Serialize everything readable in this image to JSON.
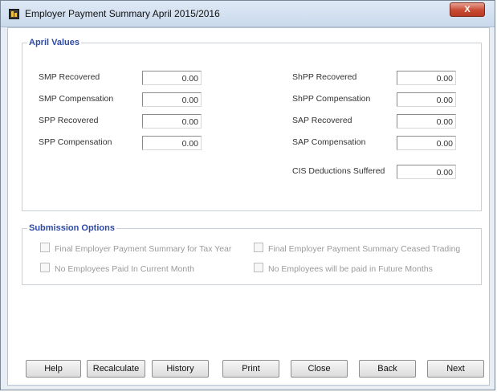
{
  "window": {
    "title": "Employer Payment Summary April 2015/2016",
    "close_label": "X"
  },
  "april_values": {
    "legend": "April Values",
    "left": [
      {
        "label": "SMP Recovered",
        "value": "0.00"
      },
      {
        "label": "SMP Compensation",
        "value": "0.00"
      },
      {
        "label": "SPP Recovered",
        "value": "0.00"
      },
      {
        "label": "SPP Compensation",
        "value": "0.00"
      }
    ],
    "right": [
      {
        "label": "ShPP Recovered",
        "value": "0.00"
      },
      {
        "label": "ShPP Compensation",
        "value": "0.00"
      },
      {
        "label": "SAP Recovered",
        "value": "0.00"
      },
      {
        "label": "SAP Compensation",
        "value": "0.00"
      },
      {
        "label": "CIS Deductions Suffered",
        "value": "0.00"
      }
    ]
  },
  "submission": {
    "legend": "Submission Options",
    "options": [
      {
        "label": "Final Employer Payment Summary for Tax Year",
        "checked": false
      },
      {
        "label": "Final Employer Payment Summary Ceased Trading",
        "checked": false
      },
      {
        "label": "No Employees Paid In Current Month",
        "checked": false
      },
      {
        "label": "No Employees will be paid in Future Months",
        "checked": false
      }
    ]
  },
  "buttons": {
    "help": "Help",
    "recalculate": "Recalculate",
    "history": "History",
    "print": "Print",
    "close": "Close",
    "back": "Back",
    "next": "Next"
  }
}
